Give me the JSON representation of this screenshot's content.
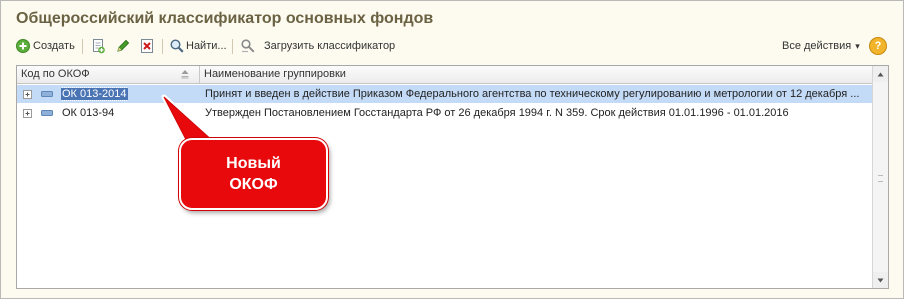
{
  "title": "Общероссийский классификатор основных фондов",
  "toolbar": {
    "create_label": "Создать",
    "find_label": "Найти...",
    "load_label": "Загрузить классификатор",
    "all_actions_label": "Все действия",
    "all_actions_arrow": "▾",
    "help_label": "?"
  },
  "table": {
    "columns": [
      "Код по ОКОФ",
      "Наименование группировки"
    ],
    "rows": [
      {
        "code": "ОК 013-2014",
        "name": "Принят и введен в действие Приказом Федерального агентства по техническому регулированию и метрологии от 12 декабря ...",
        "selected": true
      },
      {
        "code": "ОК 013-94",
        "name": "Утвержден Постановлением Госстандарта РФ от 26 декабря 1994 г. N 359.  Срок действия 01.01.1996 - 01.01.2016",
        "selected": false
      }
    ]
  },
  "callout": {
    "line1": "Новый",
    "line2": "ОКОФ",
    "color": "#e8090c"
  },
  "icons": {
    "create": "plus-circle-icon",
    "copy": "copy-icon",
    "edit": "pencil-icon",
    "delete": "delete-icon",
    "find": "magnifier-icon",
    "load": "load-classifier-icon"
  }
}
